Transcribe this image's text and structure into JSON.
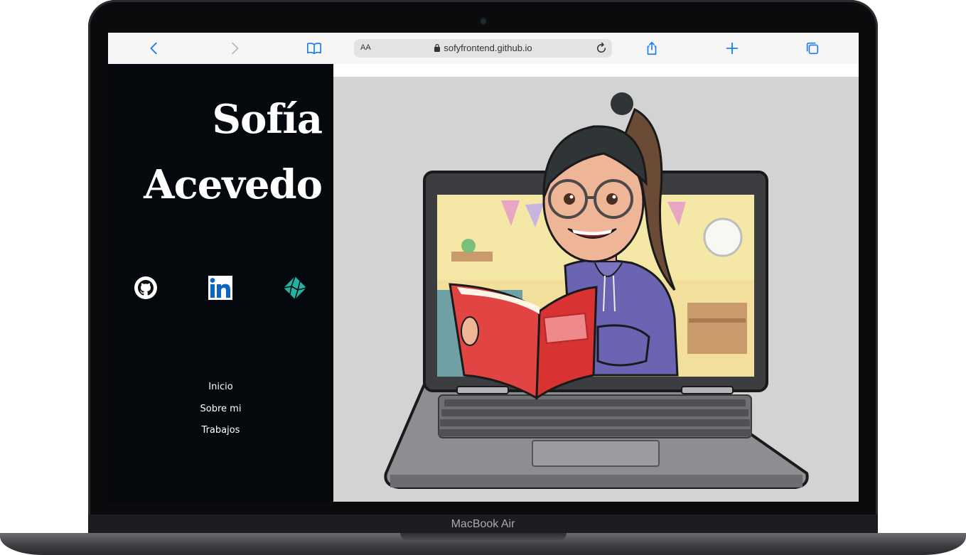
{
  "device": {
    "model_label": "MacBook Air"
  },
  "browser": {
    "text_size_label": "AA",
    "url": "sofyfrontend.github.io"
  },
  "sidebar": {
    "name_first": "Sofía",
    "name_last": "Acevedo",
    "social": [
      {
        "icon": "github-icon"
      },
      {
        "icon": "linkedin-icon"
      },
      {
        "icon": "netlify-icon"
      }
    ],
    "nav": [
      {
        "label": "Inicio"
      },
      {
        "label": "Sobre mi"
      },
      {
        "label": "Trabajos"
      }
    ]
  },
  "colors": {
    "sidebar_bg": "#05080c",
    "hero_bg": "#d3d3d3",
    "safari_blue": "#1a7ee8",
    "linkedin_blue": "#0a66c2",
    "netlify_teal": "#20b3a4"
  }
}
